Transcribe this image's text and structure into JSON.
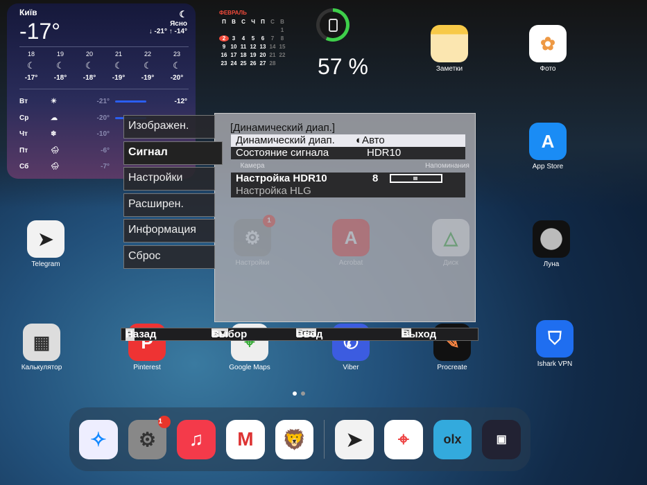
{
  "weather": {
    "city": "Київ",
    "temp": "-17°",
    "condition": "Ясно",
    "range": "↓ -21° ↑ -14°",
    "hours": [
      {
        "h": "18",
        "t": "-17°"
      },
      {
        "h": "19",
        "t": "-18°"
      },
      {
        "h": "20",
        "t": "-18°"
      },
      {
        "h": "21",
        "t": "-19°"
      },
      {
        "h": "22",
        "t": "-19°"
      },
      {
        "h": "23",
        "t": "-20°"
      }
    ],
    "days": [
      {
        "d": "Вт",
        "icon": "☀",
        "lo": "-21°",
        "hi": "-12°"
      },
      {
        "d": "Ср",
        "icon": "☁",
        "lo": "-20°",
        "hi": ""
      },
      {
        "d": "Чт",
        "icon": "❄",
        "lo": "-10°",
        "hi": ""
      },
      {
        "d": "Пт",
        "icon": "🌧",
        "lo": "-6°",
        "hi": ""
      },
      {
        "d": "Сб",
        "icon": "🌧",
        "lo": "-7°",
        "hi": ""
      }
    ]
  },
  "calendar": {
    "month": "ФЕВРАЛЬ",
    "weekdays": [
      "П",
      "В",
      "С",
      "Ч",
      "П",
      "С",
      "В"
    ],
    "today": "2"
  },
  "battery": {
    "percent_label": "57 %",
    "level": 0.57
  },
  "apps": {
    "notes": "Заметки",
    "photos": "Фото",
    "camera": "Камера",
    "reminders": "Напоминания",
    "appstore": "App Store",
    "telegram": "Telegram",
    "settings": "Настройки",
    "settings_badge": "1",
    "acrobat": "Acrobat",
    "drive": "Диск",
    "moon": "Луна",
    "calculator": "Калькулятор",
    "pinterest": "Pinterest",
    "gmaps": "Google Maps",
    "viber": "Viber",
    "procreate": "Procreate",
    "ishark": "Ishark VPN"
  },
  "dock": {
    "settings_badge": "1"
  },
  "osd": {
    "tabs": [
      "Изображен.",
      "Сигнал",
      "Настройки",
      "Расширен.",
      "Информация",
      "Сброс"
    ],
    "title": "[Динамический диап.]",
    "rows": {
      "dyn_label": "Динамический диап.",
      "dyn_value": "◐Авто",
      "state_label": "Состояние сигнала",
      "state_value": "HDR10",
      "hdr10_label": "Настройка HDR10",
      "hdr10_value": "8",
      "hlg_label": "Настройка HLG"
    },
    "hdr10_slider_fraction": 0.5,
    "footer": {
      "back": "Назад",
      "select": "Выбор",
      "enter_key": "Enter",
      "enter": "Ввод",
      "exit": "Выход"
    }
  }
}
